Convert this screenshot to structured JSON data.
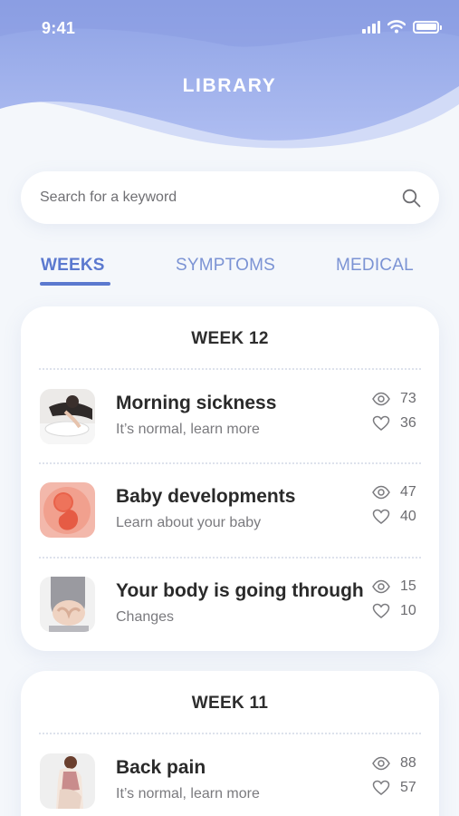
{
  "status_bar": {
    "time": "9:41"
  },
  "header": {
    "title": "LIBRARY"
  },
  "search": {
    "placeholder": "Search for a keyword",
    "icon": "search-icon"
  },
  "tabs": [
    {
      "label": "WEEKS",
      "active": true
    },
    {
      "label": "SYMPTOMS",
      "active": false
    },
    {
      "label": "MEDICAL",
      "active": false
    }
  ],
  "colors": {
    "accent": "#5b79cf",
    "tab_inactive": "#7b93d4",
    "header_top": "#8fa3e6",
    "header_bottom": "#b7c5f3",
    "background": "#f4f7fb"
  },
  "weeks": [
    {
      "title": "WEEK 12",
      "articles": [
        {
          "title": "Morning sickness",
          "subtitle": "It’s normal, learn more",
          "views": "73",
          "likes": "36",
          "thumb_icon": "morning-sickness-photo"
        },
        {
          "title": "Baby developments",
          "subtitle": "Learn about your baby",
          "views": "47",
          "likes": "40",
          "thumb_icon": "fetus-photo"
        },
        {
          "title": "Your body is going through",
          "subtitle": "Changes",
          "views": "15",
          "likes": "10",
          "thumb_icon": "belly-photo"
        }
      ]
    },
    {
      "title": "WEEK 11",
      "articles": [
        {
          "title": "Back pain",
          "subtitle": "It’s normal, learn more",
          "views": "88",
          "likes": "57",
          "thumb_icon": "back-pain-photo"
        }
      ]
    }
  ]
}
